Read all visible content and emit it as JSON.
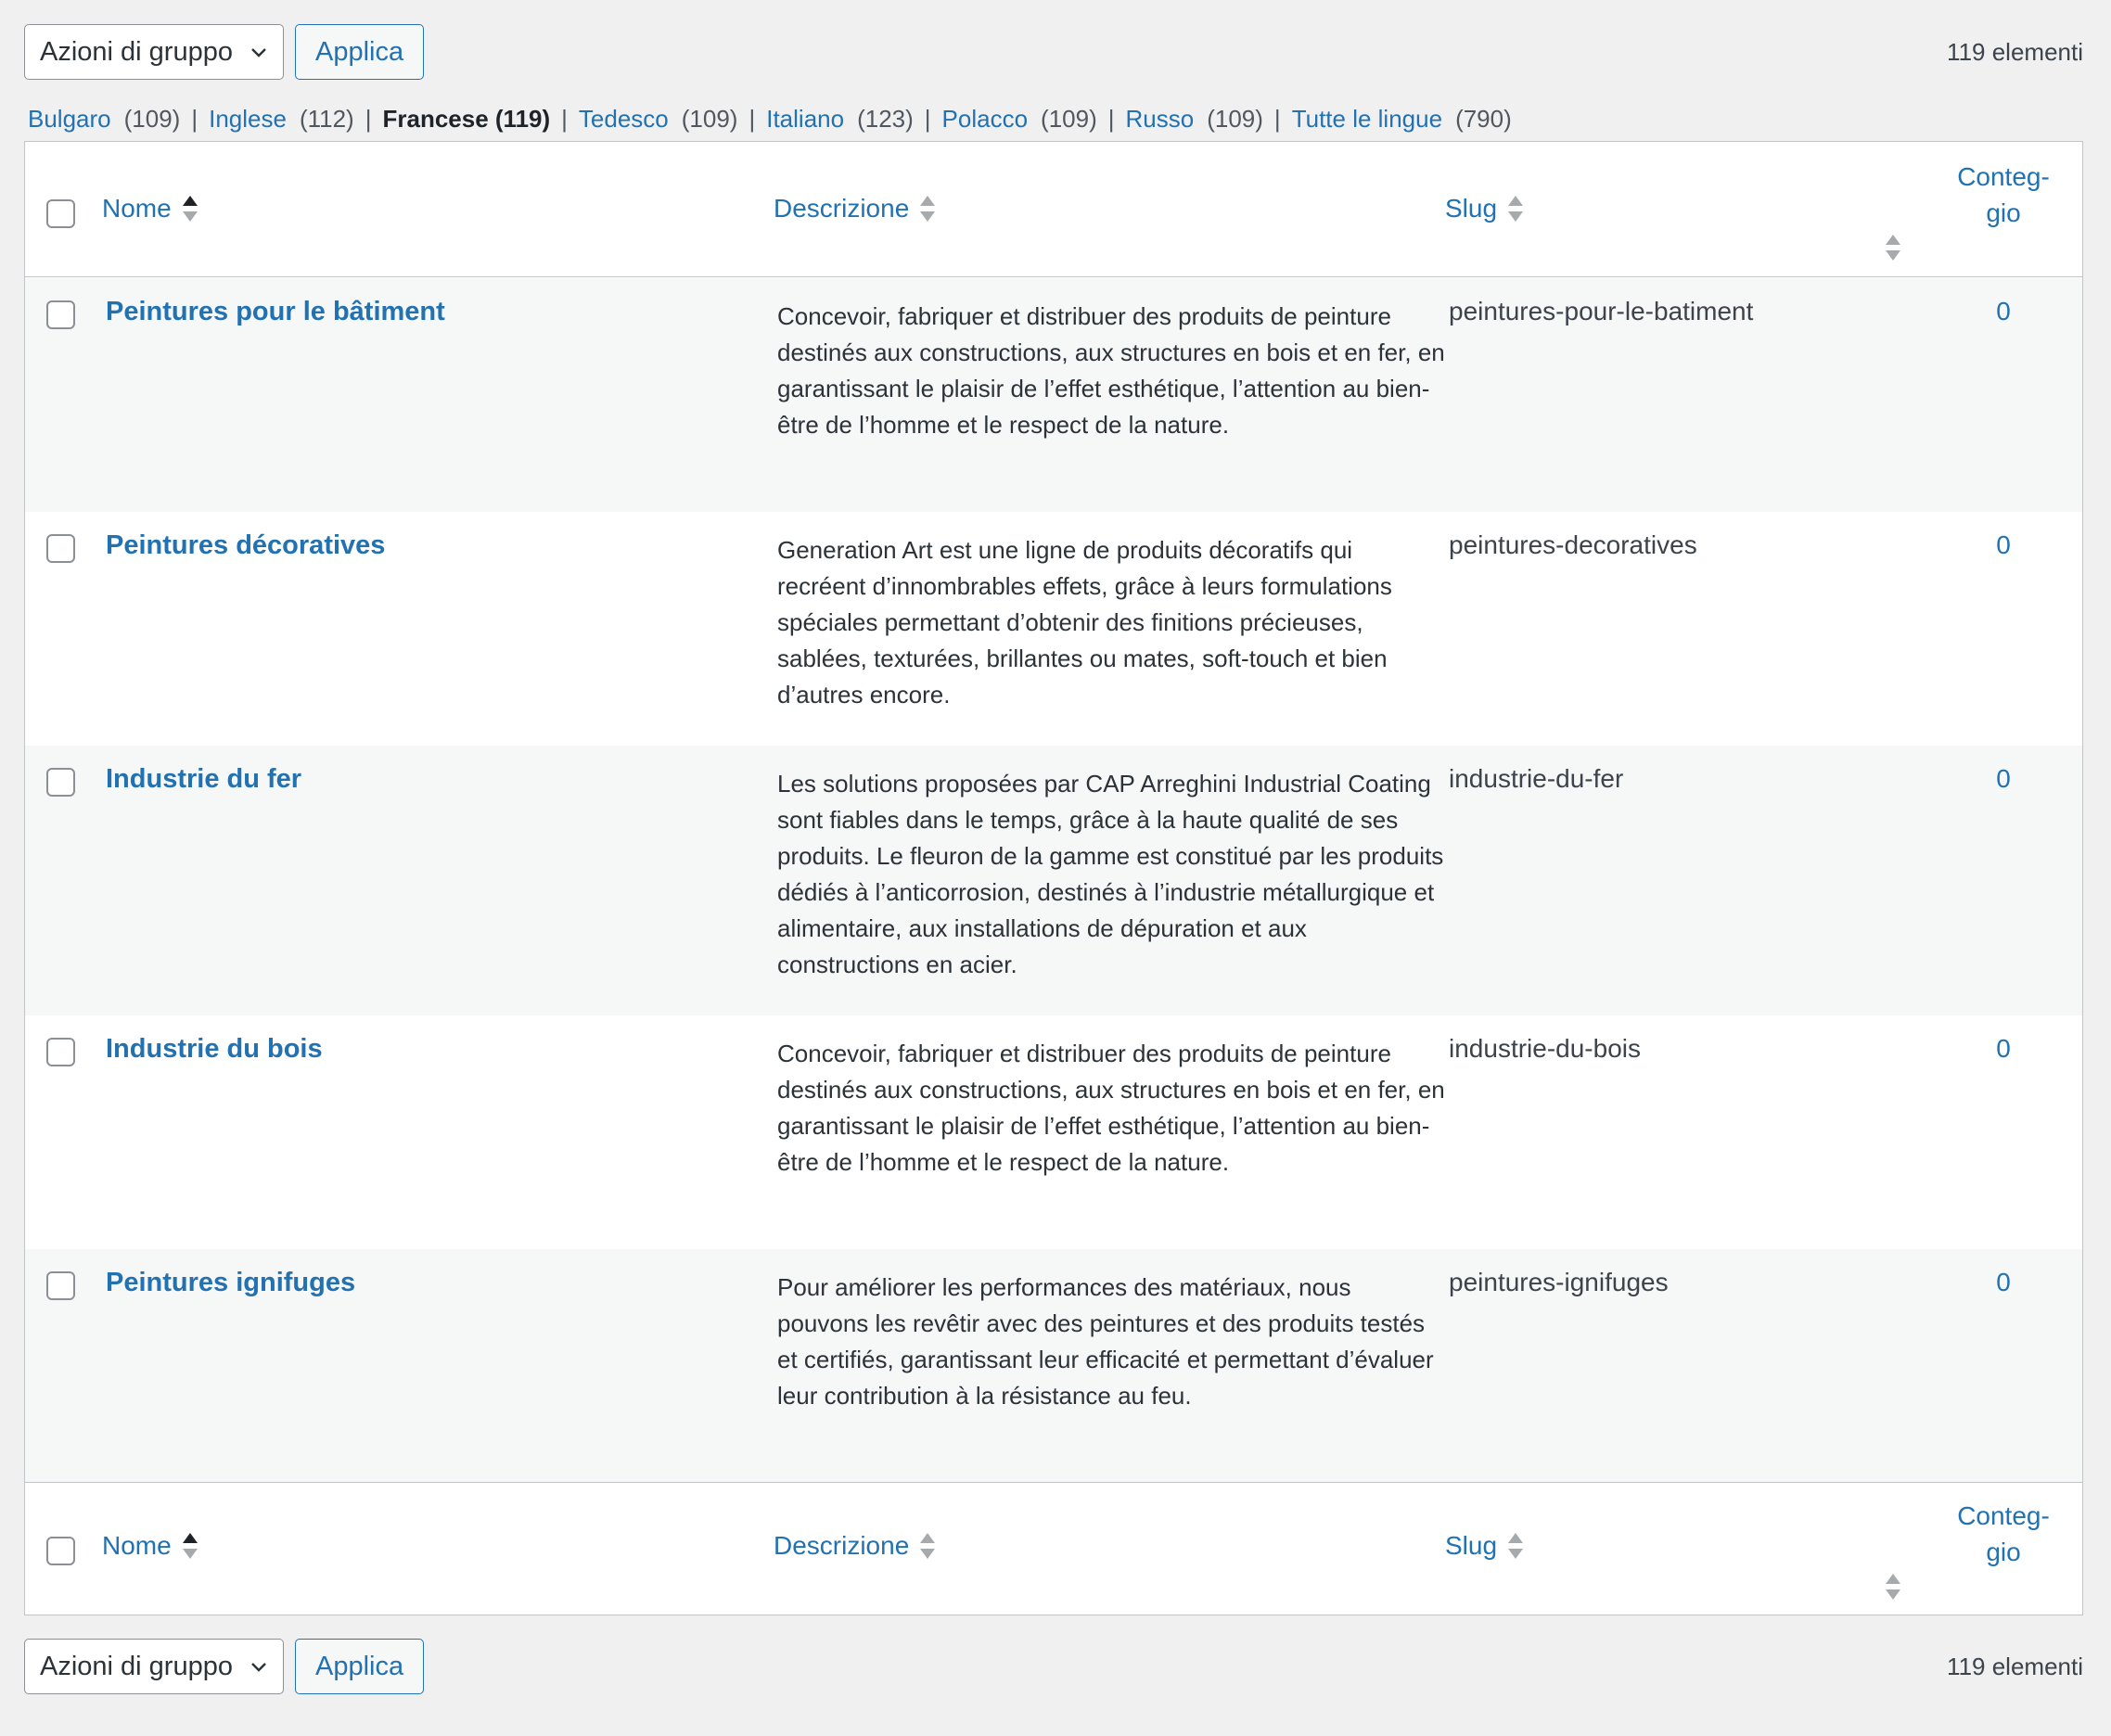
{
  "bulk_actions": {
    "label": "Azioni di gruppo",
    "apply": "Applica"
  },
  "items_count": "119 elementi",
  "languages": [
    {
      "label": "Bulgaro",
      "count": "(109)",
      "current": false
    },
    {
      "label": "Inglese",
      "count": "(112)",
      "current": false
    },
    {
      "label": "Francese (119)",
      "count": "",
      "current": true
    },
    {
      "label": "Tedesco",
      "count": "(109)",
      "current": false
    },
    {
      "label": "Italiano",
      "count": "(123)",
      "current": false
    },
    {
      "label": "Polacco",
      "count": "(109)",
      "current": false
    },
    {
      "label": "Russo",
      "count": "(109)",
      "current": false
    },
    {
      "label": "Tutte le lingue",
      "count": "(790)",
      "current": false
    }
  ],
  "columns": {
    "name": "Nome",
    "description": "Descrizione",
    "slug": "Slug",
    "count_line1": "Conteg-",
    "count_line2": "gio"
  },
  "rows": [
    {
      "name": "Peintures pour le bâtiment",
      "description": "Concevoir, fabriquer et distribuer des produits de peinture destinés aux constructions, aux structures en bois et en fer, en garantissant le plaisir de l’effet esthétique, l’attention au bien-être de l’homme et le respect de la nature.",
      "slug": "peintures-pour-le-batiment",
      "count": "0"
    },
    {
      "name": "Peintures décoratives",
      "description": "Generation Art est une ligne de produits décoratifs qui recréent d’innombrables effets, grâce à leurs formulations spéciales permettant d’obtenir des finitions précieuses, sablées, texturées, brillantes ou mates, soft-touch et bien d’autres encore.",
      "slug": "peintures-decoratives",
      "count": "0"
    },
    {
      "name": "Industrie du fer",
      "description": "Les solutions proposées par CAP Arreghini Industrial Coating sont fiables dans le temps, grâce à la haute qualité de ses produits. Le fleuron de la gamme est constitué par les produits dédiés à l’anticorrosion, destinés à l’industrie métallurgique et alimentaire, aux installations de dépuration et aux constructions en acier.",
      "slug": "industrie-du-fer",
      "count": "0"
    },
    {
      "name": "Industrie du bois",
      "description": "Concevoir, fabriquer et distribuer des produits de peinture destinés aux constructions, aux structures en bois et en fer, en garantissant le plaisir de l’effet esthétique, l’attention au bien-être de l’homme et le respect de la nature.",
      "slug": "industrie-du-bois",
      "count": "0"
    },
    {
      "name": "Peintures ignifuges",
      "description": "Pour améliorer les performances des matériaux, nous pouvons les revêtir avec des peintures et des produits testés et certifiés, garantissant leur efficacité et permettant d’évaluer leur contribution à la résistance au feu.",
      "slug": "peintures-ignifuges",
      "count": "0"
    }
  ]
}
